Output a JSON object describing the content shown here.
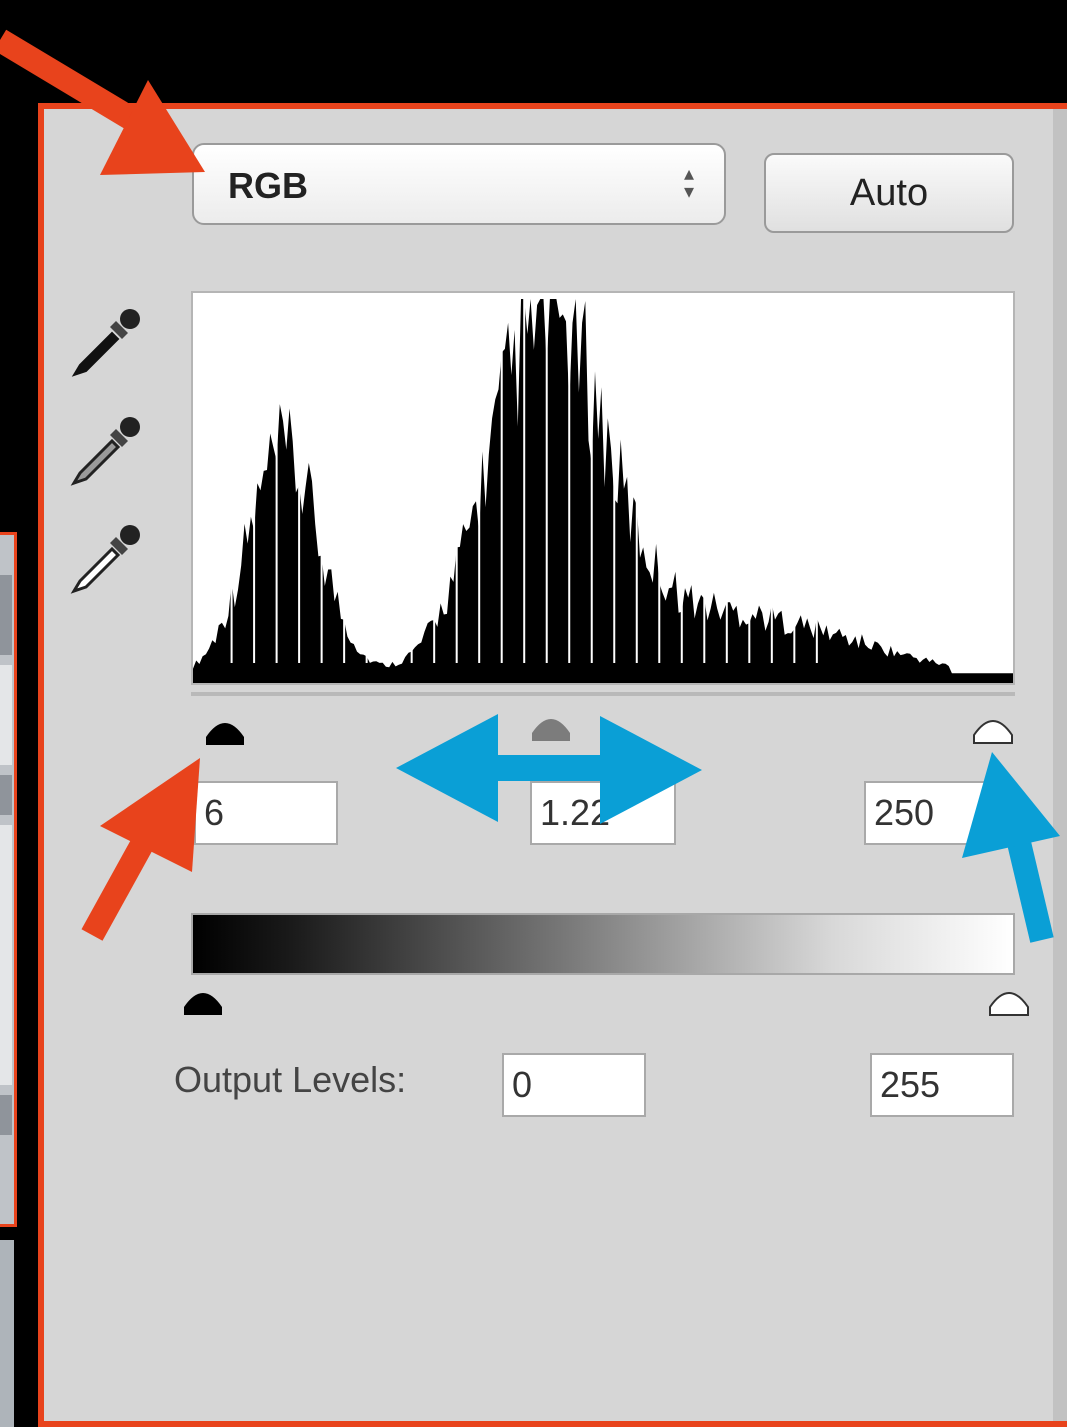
{
  "levels": {
    "channel": "RGB",
    "auto_label": "Auto",
    "input_black": "6",
    "input_gamma": "1.22",
    "input_white": "250",
    "output_label": "Output Levels:",
    "output_black": "0",
    "output_white": "255"
  },
  "colors": {
    "annotation_red": "#e8431c",
    "annotation_blue": "#0a9fd6",
    "panel_background": "#d6d6d6"
  },
  "icons": {
    "eyedroppers": [
      "black-point-eyedropper-icon",
      "gray-point-eyedropper-icon",
      "white-point-eyedropper-icon"
    ],
    "sliders": [
      "black-input-slider",
      "gamma-input-slider",
      "white-input-slider",
      "black-output-slider",
      "white-output-slider"
    ]
  }
}
